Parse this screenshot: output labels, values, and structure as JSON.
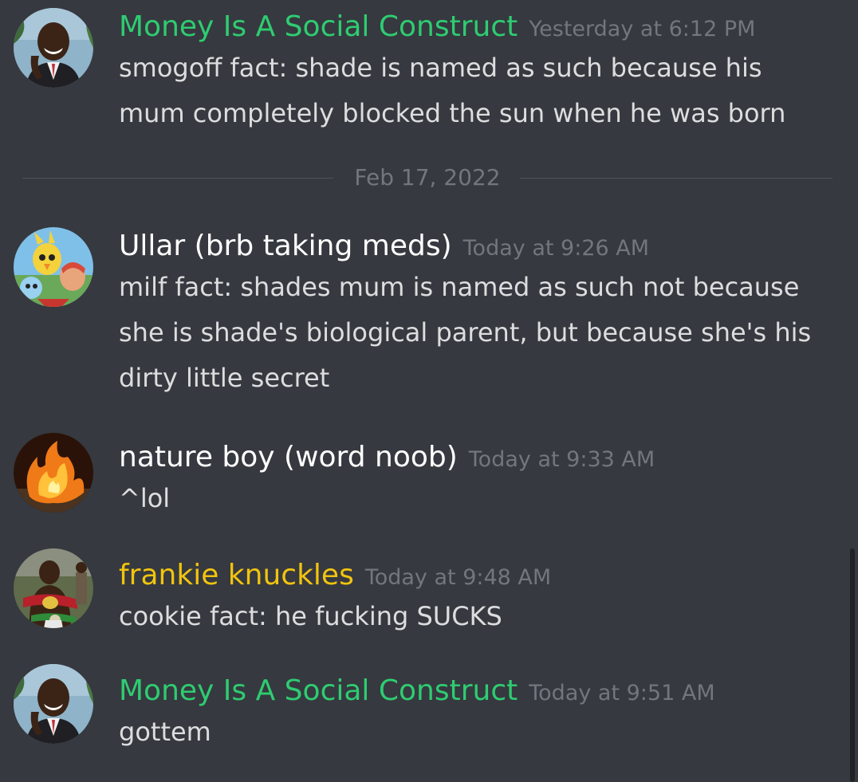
{
  "messages": [
    {
      "username": "Money Is A Social Construct",
      "username_color": "#2ecc71",
      "timestamp": "Yesterday at 6:12 PM",
      "text": "smogoff fact: shade is named as such because his\nmum completely blocked the sun when he was born",
      "avatar_icon": "avatar-man-on-phone"
    },
    {
      "username": "Ullar (brb taking meds)",
      "username_color": "#ffffff",
      "timestamp": "Today at 9:26 AM",
      "text": "milf fact: shades mum is named as such not because\nshe is shade's biological parent, but because she's his\ndirty little secret",
      "avatar_icon": "avatar-chocobo-cartoon"
    },
    {
      "username": "nature boy (word noob)",
      "username_color": "#ffffff",
      "timestamp": "Today at 9:33 AM",
      "text": "^lol",
      "avatar_icon": "avatar-fire-cat"
    },
    {
      "username": "frankie knuckles",
      "username_color": "#f1c40f",
      "timestamp": "Today at 9:48 AM",
      "text": "cookie fact: he fucking SUCKS",
      "avatar_icon": "avatar-boxer-with-belts"
    },
    {
      "username": "Money Is A Social Construct",
      "username_color": "#2ecc71",
      "timestamp": "Today at 9:51 AM",
      "text": "gottem",
      "avatar_icon": "avatar-man-on-phone"
    }
  ],
  "date_divider": "Feb 17, 2022",
  "colors": {
    "background": "#36393f",
    "timestamp": "#72767d",
    "text": "#dcddde"
  }
}
